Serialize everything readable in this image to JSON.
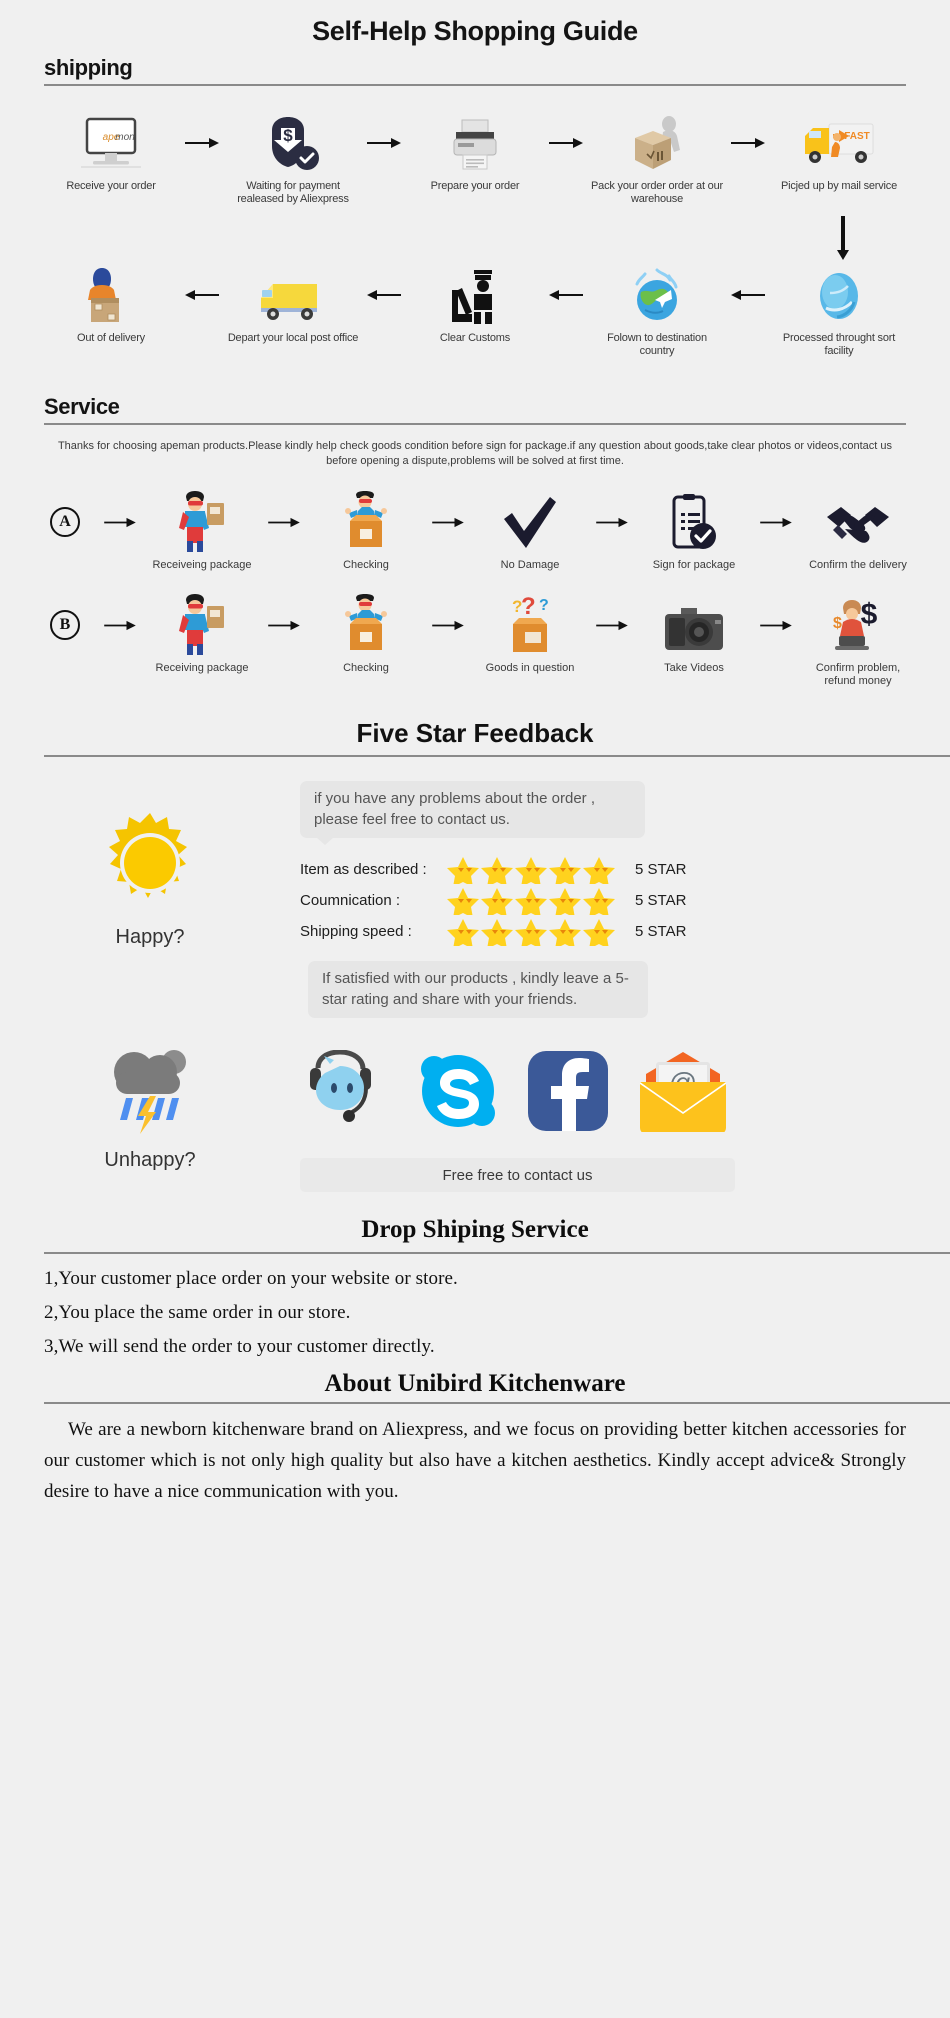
{
  "page": {
    "title": "Self-Help Shopping Guide",
    "background": "#f0f0f0"
  },
  "shipping": {
    "heading": "shipping",
    "row1": [
      {
        "label": "Receive your order",
        "icon": "monitor-apeman-icon"
      },
      {
        "label": "Waiting for payment realeased by Aliexpress",
        "icon": "payment-dollar-shield-icon"
      },
      {
        "label": "Prepare your order",
        "icon": "printer-icon"
      },
      {
        "label": "Pack your order order at our warehouse",
        "icon": "packing-box-worker-icon"
      },
      {
        "label": "Picjed up by mail service",
        "icon": "fast-delivery-truck-icon"
      }
    ],
    "row2": [
      {
        "label": "Out of delivery",
        "icon": "courier-with-box-icon"
      },
      {
        "label": "Depart your local post office",
        "icon": "yellow-van-icon"
      },
      {
        "label": "Clear Customs",
        "icon": "customs-officer-icon"
      },
      {
        "label": "Folown to destination country",
        "icon": "globe-airplane-icon"
      },
      {
        "label": "Processed throught sort facility",
        "icon": "blue-globe-icon"
      }
    ]
  },
  "service": {
    "heading": "Service",
    "note": "Thanks for choosing apeman products.Please kindly help check goods condition before sign for package.if any question about goods,take clear photos or videos,contact us before opening a dispute,problems will be solved at first time.",
    "rowA": {
      "badge": "A",
      "steps": [
        {
          "label": "Receiveing package",
          "icon": "hero-with-parcel-icon"
        },
        {
          "label": "Checking",
          "icon": "hero-opening-box-icon"
        },
        {
          "label": "No Damage",
          "icon": "check-mark-icon"
        },
        {
          "label": "Sign for package",
          "icon": "signed-clipboard-icon"
        },
        {
          "label": "Confirm the delivery",
          "icon": "handshake-icon"
        }
      ]
    },
    "rowB": {
      "badge": "B",
      "steps": [
        {
          "label": "Receiving package",
          "icon": "hero-with-parcel-icon"
        },
        {
          "label": "Checking",
          "icon": "hero-opening-box-icon"
        },
        {
          "label": "Goods in question",
          "icon": "question-box-icon"
        },
        {
          "label": "Take Videos",
          "icon": "camera-icon"
        },
        {
          "label": "Confirm problem, refund money",
          "icon": "agent-refund-icon"
        }
      ]
    }
  },
  "feedback": {
    "heading": "Five Star Feedback",
    "bubble_top": "if you have any problems about the order , please feel free to contact us.",
    "bubble_bottom": "If satisfied with our products ,  kindly leave a 5-star rating and share with your friends.",
    "happy_label": "Happy?",
    "happy_icon": "sun-icon",
    "ratings": [
      {
        "label": "Item as described :",
        "stars": 5,
        "value": "5 STAR"
      },
      {
        "label": "Coumnication :",
        "stars": 5,
        "value": "5 STAR"
      },
      {
        "label": "Shipping speed :",
        "stars": 5,
        "value": "5 STAR"
      }
    ],
    "star_color": "#ffd21e"
  },
  "contact": {
    "unhappy_label": "Unhappy?",
    "unhappy_icon": "storm-cloud-icon",
    "icons": [
      {
        "name": "trade-manager-icon",
        "color": "#7ec8f0"
      },
      {
        "name": "skype-icon",
        "color": "#00aff0"
      },
      {
        "name": "facebook-icon",
        "color": "#3b5998"
      },
      {
        "name": "email-envelope-icon",
        "color": "#ffc107"
      }
    ],
    "bar_label": "Free free to contact us"
  },
  "dropshipping": {
    "heading": "Drop Shiping Service",
    "items": [
      "1,Your customer place order on your website or store.",
      "2,You place the same order in our store.",
      "3,We will send the order to your customer directly."
    ]
  },
  "about": {
    "heading": "About Unibird Kitchenware",
    "body": "We are a newborn kitchenware brand on Aliexpress, and we focus on providing better kitchen accessories for our customer which is not only high quality but also have a kitchen aesthetics. Kindly accept advice& Strongly desire to have a nice communication with you."
  }
}
